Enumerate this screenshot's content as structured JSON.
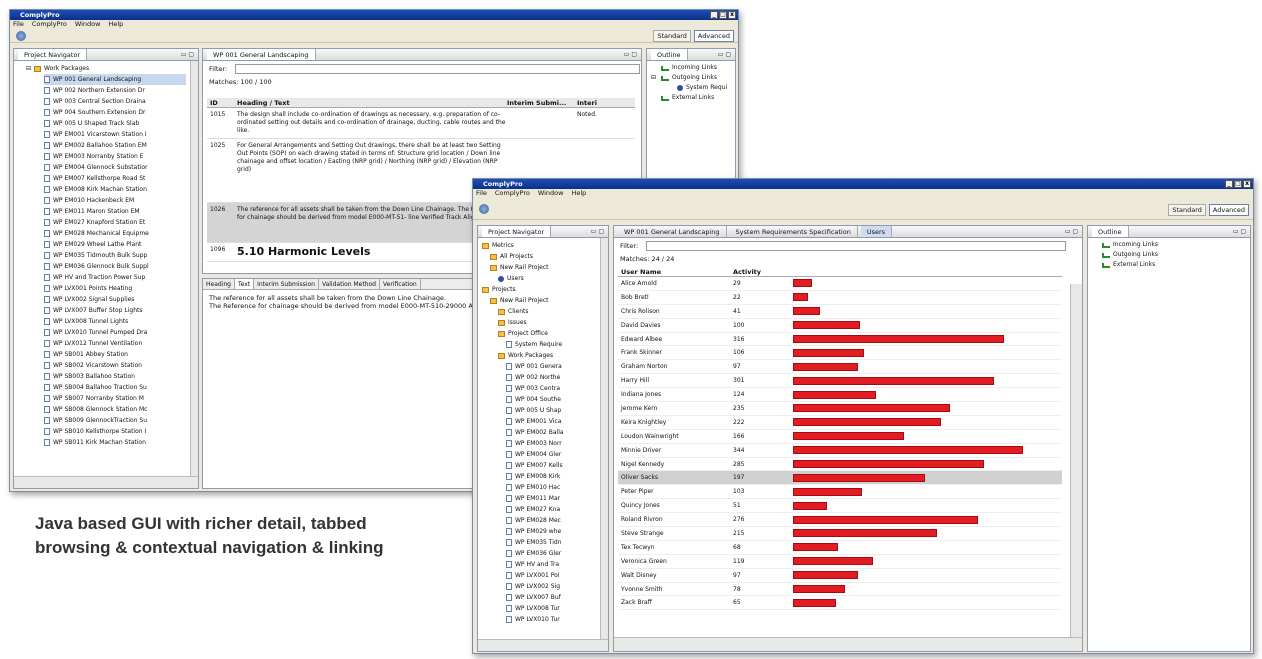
{
  "app": {
    "title": "ComplyPro",
    "menu": [
      "File",
      "ComplyPro",
      "Window",
      "Help"
    ],
    "perspectives": [
      "Standard",
      "Advanced"
    ]
  },
  "win1": {
    "navigator_tab": "Project Navigator",
    "tree_root": "Work Packages",
    "tree_items": [
      "WP 001 General Landscaping",
      "WP 002 Northern Extension Dr",
      "WP 003 Central Section Draina",
      "WP 004 Southern Extension Dr",
      "WP 005 U Shaped Track Slab",
      "WP EM001 Vicarstown Station I",
      "WP EM002 Ballahoo Station EM",
      "WP EM003 Norranby Station E",
      "WP EM004 Glennock Substatior",
      "WP EM007 Kellsthorpe Road St",
      "WP EM008 Kirk Machan Station",
      "WP EM010 Hackenbeck EM",
      "WP EM011 Maron Station EM",
      "WP EM027 Knapford Station Et",
      "WP EM028 Mechanical Equipme",
      "WP EM029 Wheel Lathe Plant",
      "WP EM035 Tidmouth Bulk Supp",
      "WP EM036 Glennock Bulk Suppl",
      "WP HV and Traction Power Sup",
      "WP LVX001 Points Heating",
      "WP LVX002 Signal Supplies",
      "WP LVX007 Buffer Stop Lights",
      "WP LVX008 Tunnel Lights",
      "WP LVX010 Tunnel Pumped Dra",
      "WP LVX012 Tunnel Ventilation",
      "WP SB001 Abbey Station",
      "WP SB002 Vicarstown Station",
      "WP SB003 Ballahoo Station",
      "WP SB004 Ballahoo Traction Su",
      "WP SB007 Norranby Station M",
      "WP SB008 Glennock Station Mc",
      "WP SB009 GlennockTraction Su",
      "WP SB010 Kellsthorpe Station I",
      "WP SB011 Kirk Machan Station"
    ],
    "editor_tab": "WP 001 General Landscaping",
    "filter_label": "Filter:",
    "matches": "Matches: 100 / 100",
    "columns": [
      "ID",
      "Heading / Text",
      "Interim Submi...",
      "Interi"
    ],
    "rows": [
      {
        "id": "1015",
        "text": "The design shall include co-ordination of drawings as necessary, e.g. preparation of co-ordinated setting out details and co-ordination of drainage, ducting, cable routes and the like.",
        "interim": "Noted."
      },
      {
        "id": "1025",
        "text": "For General Arrangements and Setting Out drawings, there shall be at least two Setting Out Points (SOP) on each drawing stated in terms of: Structure grid location / Down line chainage and offset location / Easting (NRP grid) / Northing (NRP grid) / Elevation (NRP grid)",
        "interim": ""
      },
      {
        "id": "1026",
        "text": "The reference for all assets shall be taken from the Down Line Chainage. The Reference for chainage should be derived from model E000-MT-51- line Verified Track Alignment.",
        "interim": ""
      },
      {
        "id": "1096",
        "text": "5.10 Harmonic Levels",
        "interim": ""
      }
    ],
    "detail_tabs": [
      "Heading",
      "Text",
      "Interim Submission",
      "Validation Method",
      "Verification"
    ],
    "detail_lines": [
      "The reference for all assets shall be taken from the Down Line Chainage.",
      "The Reference for chainage should be derived from model E000-MT-510-29000 A"
    ],
    "outline_tab": "Outline",
    "outline": [
      "Incoming Links",
      "Outgoing Links",
      "System Requi",
      "External Links"
    ]
  },
  "win2": {
    "navigator_tab": "Project Navigator",
    "tree": [
      {
        "label": "Metrics",
        "type": "folder"
      },
      {
        "label": "All Projects",
        "type": "folder"
      },
      {
        "label": "New Rail Project",
        "type": "folder"
      },
      {
        "label": "Users",
        "type": "dot"
      },
      {
        "label": "Projects",
        "type": "folder"
      },
      {
        "label": "New Rail Project",
        "type": "folder"
      },
      {
        "label": "Clients",
        "type": "folder"
      },
      {
        "label": "Issues",
        "type": "folder"
      },
      {
        "label": "Project Office",
        "type": "folder"
      },
      {
        "label": "System Require",
        "type": "page"
      },
      {
        "label": "Work Packages",
        "type": "folder"
      },
      {
        "label": "WP 001 Genera",
        "type": "page"
      },
      {
        "label": "WP 002 Northe",
        "type": "page"
      },
      {
        "label": "WP 003 Centra",
        "type": "page"
      },
      {
        "label": "WP 004 Southe",
        "type": "page"
      },
      {
        "label": "WP 005 U Shap",
        "type": "page"
      },
      {
        "label": "WP EM001 Vica",
        "type": "page"
      },
      {
        "label": "WP EM002 Balla",
        "type": "page"
      },
      {
        "label": "WP EM003 Norr",
        "type": "page"
      },
      {
        "label": "WP EM004 Gler",
        "type": "page"
      },
      {
        "label": "WP EM007 Kells",
        "type": "page"
      },
      {
        "label": "WP EM008 Kirk",
        "type": "page"
      },
      {
        "label": "WP EM010 Hac",
        "type": "page"
      },
      {
        "label": "WP EM011 Mar",
        "type": "page"
      },
      {
        "label": "WP EM027 Kna",
        "type": "page"
      },
      {
        "label": "WP EM028 Mec",
        "type": "page"
      },
      {
        "label": "WP EM029 whe",
        "type": "page"
      },
      {
        "label": "WP EM035 Tidn",
        "type": "page"
      },
      {
        "label": "WP EM036 Gler",
        "type": "page"
      },
      {
        "label": "WP HV and Tra",
        "type": "page"
      },
      {
        "label": "WP LVX001 Poi",
        "type": "page"
      },
      {
        "label": "WP LVX002 Sig",
        "type": "page"
      },
      {
        "label": "WP LVX007 Buf",
        "type": "page"
      },
      {
        "label": "WP LVX008 Tur",
        "type": "page"
      },
      {
        "label": "WP LVX010 Tur",
        "type": "page"
      }
    ],
    "tabs": [
      "WP 001 General Landscaping",
      "System Requirements Specification",
      "Users"
    ],
    "filter_label": "Filter:",
    "matches": "Matches: 24 / 24",
    "columns": [
      "User Name",
      "Activity"
    ],
    "users": [
      {
        "name": "Alice Arnold",
        "activity": 29
      },
      {
        "name": "Bob Bretl",
        "activity": 22
      },
      {
        "name": "Chris Rolison",
        "activity": 41
      },
      {
        "name": "David Davies",
        "activity": 100
      },
      {
        "name": "Edward Albee",
        "activity": 316
      },
      {
        "name": "Frank Skinner",
        "activity": 106
      },
      {
        "name": "Graham Norton",
        "activity": 97
      },
      {
        "name": "Harry Hill",
        "activity": 301
      },
      {
        "name": "Indiana Jones",
        "activity": 124
      },
      {
        "name": "Jerome Kern",
        "activity": 235
      },
      {
        "name": "Keira Knightley",
        "activity": 222
      },
      {
        "name": "Loudon Wainwright",
        "activity": 166
      },
      {
        "name": "Minnie Driver",
        "activity": 344
      },
      {
        "name": "Nigel Kennedy",
        "activity": 285
      },
      {
        "name": "Oliver Sacks",
        "activity": 197
      },
      {
        "name": "Peter Piper",
        "activity": 103
      },
      {
        "name": "Quincy Jones",
        "activity": 51
      },
      {
        "name": "Roland Rivron",
        "activity": 276
      },
      {
        "name": "Steve Strange",
        "activity": 215
      },
      {
        "name": "Tex Tecwyn",
        "activity": 68
      },
      {
        "name": "Veronica Green",
        "activity": 119
      },
      {
        "name": "Walt Disney",
        "activity": 97
      },
      {
        "name": "Yvonne Smith",
        "activity": 78
      },
      {
        "name": "Zack Braff",
        "activity": 65
      }
    ],
    "selected_user": "Oliver Sacks",
    "outline_tab": "Outline",
    "outline": [
      "Incoming Links",
      "Outgoing Links",
      "External Links"
    ]
  },
  "caption": [
    "Java based GUI with richer detail, tabbed",
    "browsing & contextual navigation & linking"
  ],
  "colors": {
    "bar": "#e31b23",
    "titlebar": "#0b2f8a"
  }
}
